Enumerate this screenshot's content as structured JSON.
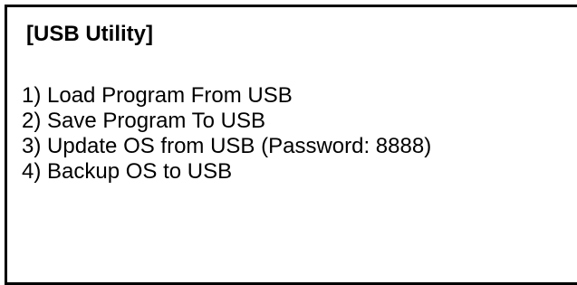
{
  "screen": {
    "title": "[USB Utility]",
    "menu_items": [
      "1) Load Program From USB",
      "2) Save Program To USB",
      "3) Update OS from USB (Password: 8888)",
      "4) Backup OS to USB"
    ]
  }
}
